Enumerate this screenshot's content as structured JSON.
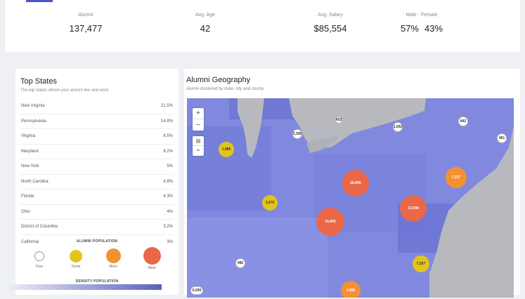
{
  "stats": {
    "alumni_label": "Alumni",
    "alumni_value": "137,477",
    "avg_age_label": "Avg. Age",
    "avg_age_value": "42",
    "avg_salary_label": "Avg. Salary",
    "avg_salary_value": "$85,554",
    "gender_label": "Male · Female",
    "male_pct": "57%",
    "female_pct": "43%"
  },
  "top_states": {
    "title": "Top States",
    "subtitle": "The top states where your alumni live and work",
    "rows": [
      {
        "name": "New Virginia",
        "value": "21.5%"
      },
      {
        "name": "Pennsylvania",
        "value": "14.8%"
      },
      {
        "name": "Virginia",
        "value": "6.5%"
      },
      {
        "name": "Maryland",
        "value": "6.2%"
      },
      {
        "name": "New York",
        "value": "5%"
      },
      {
        "name": "North Carolina",
        "value": "4.8%"
      },
      {
        "name": "Florida",
        "value": "4.3%"
      },
      {
        "name": "Ohio",
        "value": "4%"
      },
      {
        "name": "District of Columbia",
        "value": "3.2%"
      },
      {
        "name": "California",
        "value": "3%"
      }
    ]
  },
  "legend": {
    "population_title": "ALUMNI POPULATION",
    "levels": [
      "Few",
      "Some",
      "More",
      "Most"
    ],
    "density_title": "DENSITY POPULATION"
  },
  "geography": {
    "title": "Alumni Geography",
    "subtitle": "Alumni clustered by state, city and county",
    "clusters": [
      "1,985",
      "3,279",
      "26,899",
      "15,890",
      "13,098",
      "7,227",
      "7,207",
      "4,080",
      "3,290",
      "1,062",
      "842",
      "461",
      "485",
      "453",
      "6,090"
    ]
  },
  "colors": {
    "accent": "#4a55c9",
    "few": "#ffffff",
    "some": "#e3c41a",
    "more": "#f39132",
    "most": "#ea6747",
    "density_low": "#eceef9",
    "density_high": "#5b5fbf",
    "water": "#b7b9be"
  }
}
